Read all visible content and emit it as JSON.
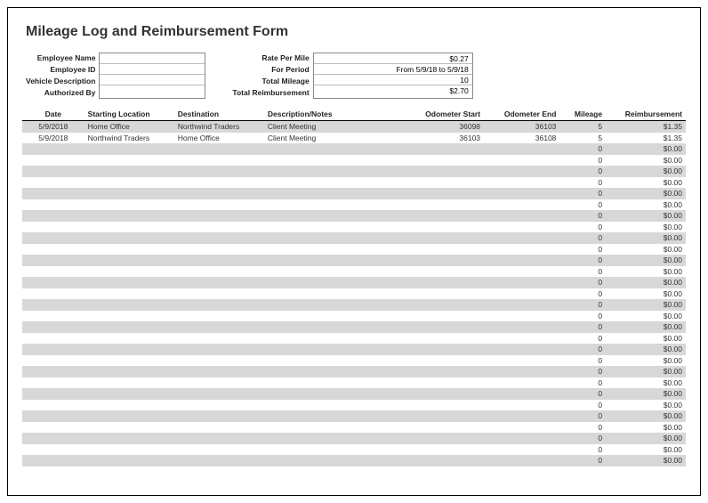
{
  "title": "Mileage Log and Reimbursement Form",
  "header_left": {
    "labels": [
      "Employee Name",
      "Employee ID",
      "Vehicle Description",
      "Authorized By"
    ],
    "values": [
      "",
      "",
      "",
      ""
    ]
  },
  "header_right": {
    "labels": [
      "Rate Per Mile",
      "For Period",
      "Total Mileage",
      "Total Reimbursement"
    ],
    "values": [
      "$0.27",
      "From 5/9/18 to 5/9/18",
      "10",
      "$2.70"
    ]
  },
  "columns": [
    "Date",
    "Starting Location",
    "Destination",
    "Description/Notes",
    "Odometer Start",
    "Odometer End",
    "Mileage",
    "Reimbursement"
  ],
  "rows": [
    {
      "date": "5/9/2018",
      "start": "Home Office",
      "dest": "Northwind Traders",
      "desc": "Client Meeting",
      "ostart": "36098",
      "oend": "36103",
      "mileage": "5",
      "reimb": "$1.35"
    },
    {
      "date": "5/9/2018",
      "start": "Northwind Traders",
      "dest": "Home Office",
      "desc": "Client Meeting",
      "ostart": "36103",
      "oend": "36108",
      "mileage": "5",
      "reimb": "$1.35"
    },
    {
      "date": "",
      "start": "",
      "dest": "",
      "desc": "",
      "ostart": "",
      "oend": "",
      "mileage": "0",
      "reimb": "$0.00"
    },
    {
      "date": "",
      "start": "",
      "dest": "",
      "desc": "",
      "ostart": "",
      "oend": "",
      "mileage": "0",
      "reimb": "$0.00"
    },
    {
      "date": "",
      "start": "",
      "dest": "",
      "desc": "",
      "ostart": "",
      "oend": "",
      "mileage": "0",
      "reimb": "$0.00"
    },
    {
      "date": "",
      "start": "",
      "dest": "",
      "desc": "",
      "ostart": "",
      "oend": "",
      "mileage": "0",
      "reimb": "$0.00"
    },
    {
      "date": "",
      "start": "",
      "dest": "",
      "desc": "",
      "ostart": "",
      "oend": "",
      "mileage": "0",
      "reimb": "$0.00"
    },
    {
      "date": "",
      "start": "",
      "dest": "",
      "desc": "",
      "ostart": "",
      "oend": "",
      "mileage": "0",
      "reimb": "$0.00"
    },
    {
      "date": "",
      "start": "",
      "dest": "",
      "desc": "",
      "ostart": "",
      "oend": "",
      "mileage": "0",
      "reimb": "$0.00"
    },
    {
      "date": "",
      "start": "",
      "dest": "",
      "desc": "",
      "ostart": "",
      "oend": "",
      "mileage": "0",
      "reimb": "$0.00"
    },
    {
      "date": "",
      "start": "",
      "dest": "",
      "desc": "",
      "ostart": "",
      "oend": "",
      "mileage": "0",
      "reimb": "$0.00"
    },
    {
      "date": "",
      "start": "",
      "dest": "",
      "desc": "",
      "ostart": "",
      "oend": "",
      "mileage": "0",
      "reimb": "$0.00"
    },
    {
      "date": "",
      "start": "",
      "dest": "",
      "desc": "",
      "ostart": "",
      "oend": "",
      "mileage": "0",
      "reimb": "$0.00"
    },
    {
      "date": "",
      "start": "",
      "dest": "",
      "desc": "",
      "ostart": "",
      "oend": "",
      "mileage": "0",
      "reimb": "$0.00"
    },
    {
      "date": "",
      "start": "",
      "dest": "",
      "desc": "",
      "ostart": "",
      "oend": "",
      "mileage": "0",
      "reimb": "$0.00"
    },
    {
      "date": "",
      "start": "",
      "dest": "",
      "desc": "",
      "ostart": "",
      "oend": "",
      "mileage": "0",
      "reimb": "$0.00"
    },
    {
      "date": "",
      "start": "",
      "dest": "",
      "desc": "",
      "ostart": "",
      "oend": "",
      "mileage": "0",
      "reimb": "$0.00"
    },
    {
      "date": "",
      "start": "",
      "dest": "",
      "desc": "",
      "ostart": "",
      "oend": "",
      "mileage": "0",
      "reimb": "$0.00"
    },
    {
      "date": "",
      "start": "",
      "dest": "",
      "desc": "",
      "ostart": "",
      "oend": "",
      "mileage": "0",
      "reimb": "$0.00"
    },
    {
      "date": "",
      "start": "",
      "dest": "",
      "desc": "",
      "ostart": "",
      "oend": "",
      "mileage": "0",
      "reimb": "$0.00"
    },
    {
      "date": "",
      "start": "",
      "dest": "",
      "desc": "",
      "ostart": "",
      "oend": "",
      "mileage": "0",
      "reimb": "$0.00"
    },
    {
      "date": "",
      "start": "",
      "dest": "",
      "desc": "",
      "ostart": "",
      "oend": "",
      "mileage": "0",
      "reimb": "$0.00"
    },
    {
      "date": "",
      "start": "",
      "dest": "",
      "desc": "",
      "ostart": "",
      "oend": "",
      "mileage": "0",
      "reimb": "$0.00"
    },
    {
      "date": "",
      "start": "",
      "dest": "",
      "desc": "",
      "ostart": "",
      "oend": "",
      "mileage": "0",
      "reimb": "$0.00"
    },
    {
      "date": "",
      "start": "",
      "dest": "",
      "desc": "",
      "ostart": "",
      "oend": "",
      "mileage": "0",
      "reimb": "$0.00"
    },
    {
      "date": "",
      "start": "",
      "dest": "",
      "desc": "",
      "ostart": "",
      "oend": "",
      "mileage": "0",
      "reimb": "$0.00"
    },
    {
      "date": "",
      "start": "",
      "dest": "",
      "desc": "",
      "ostart": "",
      "oend": "",
      "mileage": "0",
      "reimb": "$0.00"
    },
    {
      "date": "",
      "start": "",
      "dest": "",
      "desc": "",
      "ostart": "",
      "oend": "",
      "mileage": "0",
      "reimb": "$0.00"
    },
    {
      "date": "",
      "start": "",
      "dest": "",
      "desc": "",
      "ostart": "",
      "oend": "",
      "mileage": "0",
      "reimb": "$0.00"
    },
    {
      "date": "",
      "start": "",
      "dest": "",
      "desc": "",
      "ostart": "",
      "oend": "",
      "mileage": "0",
      "reimb": "$0.00"
    },
    {
      "date": "",
      "start": "",
      "dest": "",
      "desc": "",
      "ostart": "",
      "oend": "",
      "mileage": "0",
      "reimb": "$0.00"
    }
  ]
}
